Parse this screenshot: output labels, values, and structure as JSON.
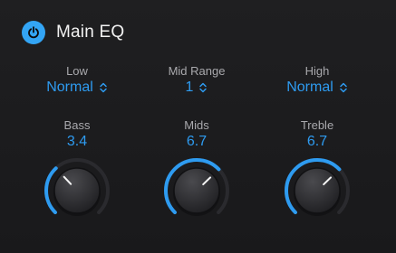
{
  "header": {
    "title": "Main EQ",
    "power_icon": "power-icon",
    "power_on": true
  },
  "colors": {
    "accent": "#2e9bf0",
    "track": "#2a2a2e",
    "label": "#a9a9ad"
  },
  "selectors": [
    {
      "label": "Low",
      "value": "Normal"
    },
    {
      "label": "Mid Range",
      "value": "1"
    },
    {
      "label": "High",
      "value": "Normal"
    }
  ],
  "knobs": [
    {
      "label": "Bass",
      "value": "3.4",
      "level": 0.34
    },
    {
      "label": "Mids",
      "value": "6.7",
      "level": 0.67
    },
    {
      "label": "Treble",
      "value": "6.7",
      "level": 0.67
    }
  ]
}
